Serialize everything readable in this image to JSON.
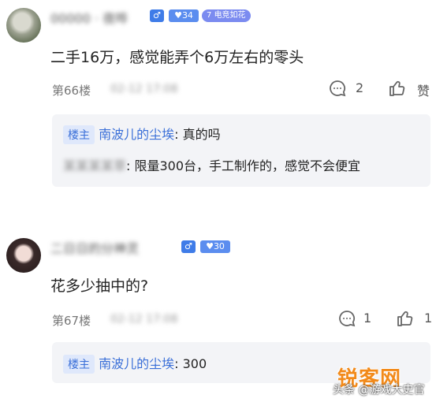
{
  "comments": [
    {
      "username": "00000 · 夜哗",
      "gender_symbol": "♂",
      "level": "34",
      "honor_level": "7",
      "honor_title": "电竞如花",
      "content": "二手16万，感觉能弄个6万左右的零头",
      "floor": "第66楼",
      "time": "02-12 17:08",
      "comment_count": "2",
      "like_label": "赞",
      "replies": [
        {
          "tag": "楼主",
          "name": "南波儿的尘埃",
          "text": ": 真的吗"
        },
        {
          "tag": "",
          "name": "某某某某草",
          "text": ": 限量300台，手工制作的，感觉不会便宜"
        }
      ]
    },
    {
      "username": "二日日的分神灵",
      "gender_symbol": "♂",
      "level": "30",
      "content": "花多少抽中的?",
      "floor": "第67楼",
      "time": "02-12 17:08",
      "comment_count": "1",
      "like_count": "1",
      "replies": [
        {
          "tag": "楼主",
          "name": "南波儿的尘埃",
          "text": ": 300"
        }
      ]
    }
  ],
  "watermark": {
    "source": "头条 @游戏大史官",
    "logo": "锐客网"
  }
}
